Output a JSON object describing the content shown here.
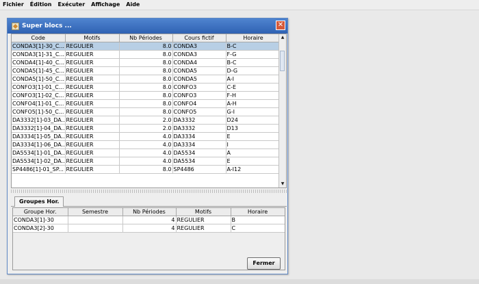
{
  "menubar": {
    "items": [
      "Fichier",
      "Édition",
      "Exécuter",
      "Affichage",
      "Aide"
    ]
  },
  "dialog": {
    "title": "Super blocs ...",
    "close_symbol": "✕",
    "main_table": {
      "columns": [
        "Code",
        "Motifs",
        "Nb Périodes",
        "Cours fictif",
        "Horaire"
      ],
      "rows": [
        [
          "CONDA3[1]-30_C...",
          "REGULIER",
          "8.0",
          "CONDA3",
          "B-C"
        ],
        [
          "CONDA3[1]-31_C...",
          "REGULIER",
          "8.0",
          "CONDA3",
          "F-G"
        ],
        [
          "CONDA4[1]-40_C...",
          "REGULIER",
          "8.0",
          "CONDA4",
          "B-C"
        ],
        [
          "CONDA5[1]-45_C...",
          "REGULIER",
          "8.0",
          "CONDA5",
          "D-G"
        ],
        [
          "CONDA5[1]-50_C...",
          "REGULIER",
          "8.0",
          "CONDA5",
          "A-I"
        ],
        [
          "CONFO3[1]-01_C...",
          "REGULIER",
          "8.0",
          "CONFO3",
          "C-E"
        ],
        [
          "CONFO3[1]-02_C...",
          "REGULIER",
          "8.0",
          "CONFO3",
          "F-H"
        ],
        [
          "CONFO4[1]-01_C...",
          "REGULIER",
          "8.0",
          "CONFO4",
          "A-H"
        ],
        [
          "CONFO5[1]-50_C...",
          "REGULIER",
          "8.0",
          "CONFO5",
          "G-I"
        ],
        [
          "DA3332[1]-03_DA...",
          "REGULIER",
          "2.0",
          "DA3332",
          "D24"
        ],
        [
          "DA3332[1]-04_DA...",
          "REGULIER",
          "2.0",
          "DA3332",
          "D13"
        ],
        [
          "DA3334[1]-05_DA...",
          "REGULIER",
          "4.0",
          "DA3334",
          "E"
        ],
        [
          "DA3334[1]-06_DA...",
          "REGULIER",
          "4.0",
          "DA3334",
          "I"
        ],
        [
          "DA5534[1]-01_DA...",
          "REGULIER",
          "4.0",
          "DA5534",
          "A"
        ],
        [
          "DA5534[1]-02_DA...",
          "REGULIER",
          "4.0",
          "DA5534",
          "E"
        ],
        [
          "SP4486[1]-01_SP...",
          "REGULIER",
          "8.0",
          "SP4486",
          "A-I12"
        ]
      ]
    },
    "tab_label": "Groupes Hor.",
    "groups_table": {
      "columns": [
        "Groupe Hor.",
        "Semestre",
        "Nb Périodes",
        "Motifs",
        "Horaire"
      ],
      "rows": [
        [
          "CONDA3[1]-30",
          "",
          "4",
          "REGULIER",
          "B"
        ],
        [
          "CONDA3[2]-30",
          "",
          "4",
          "REGULIER",
          "C"
        ]
      ]
    },
    "close_button": "Fermer"
  }
}
